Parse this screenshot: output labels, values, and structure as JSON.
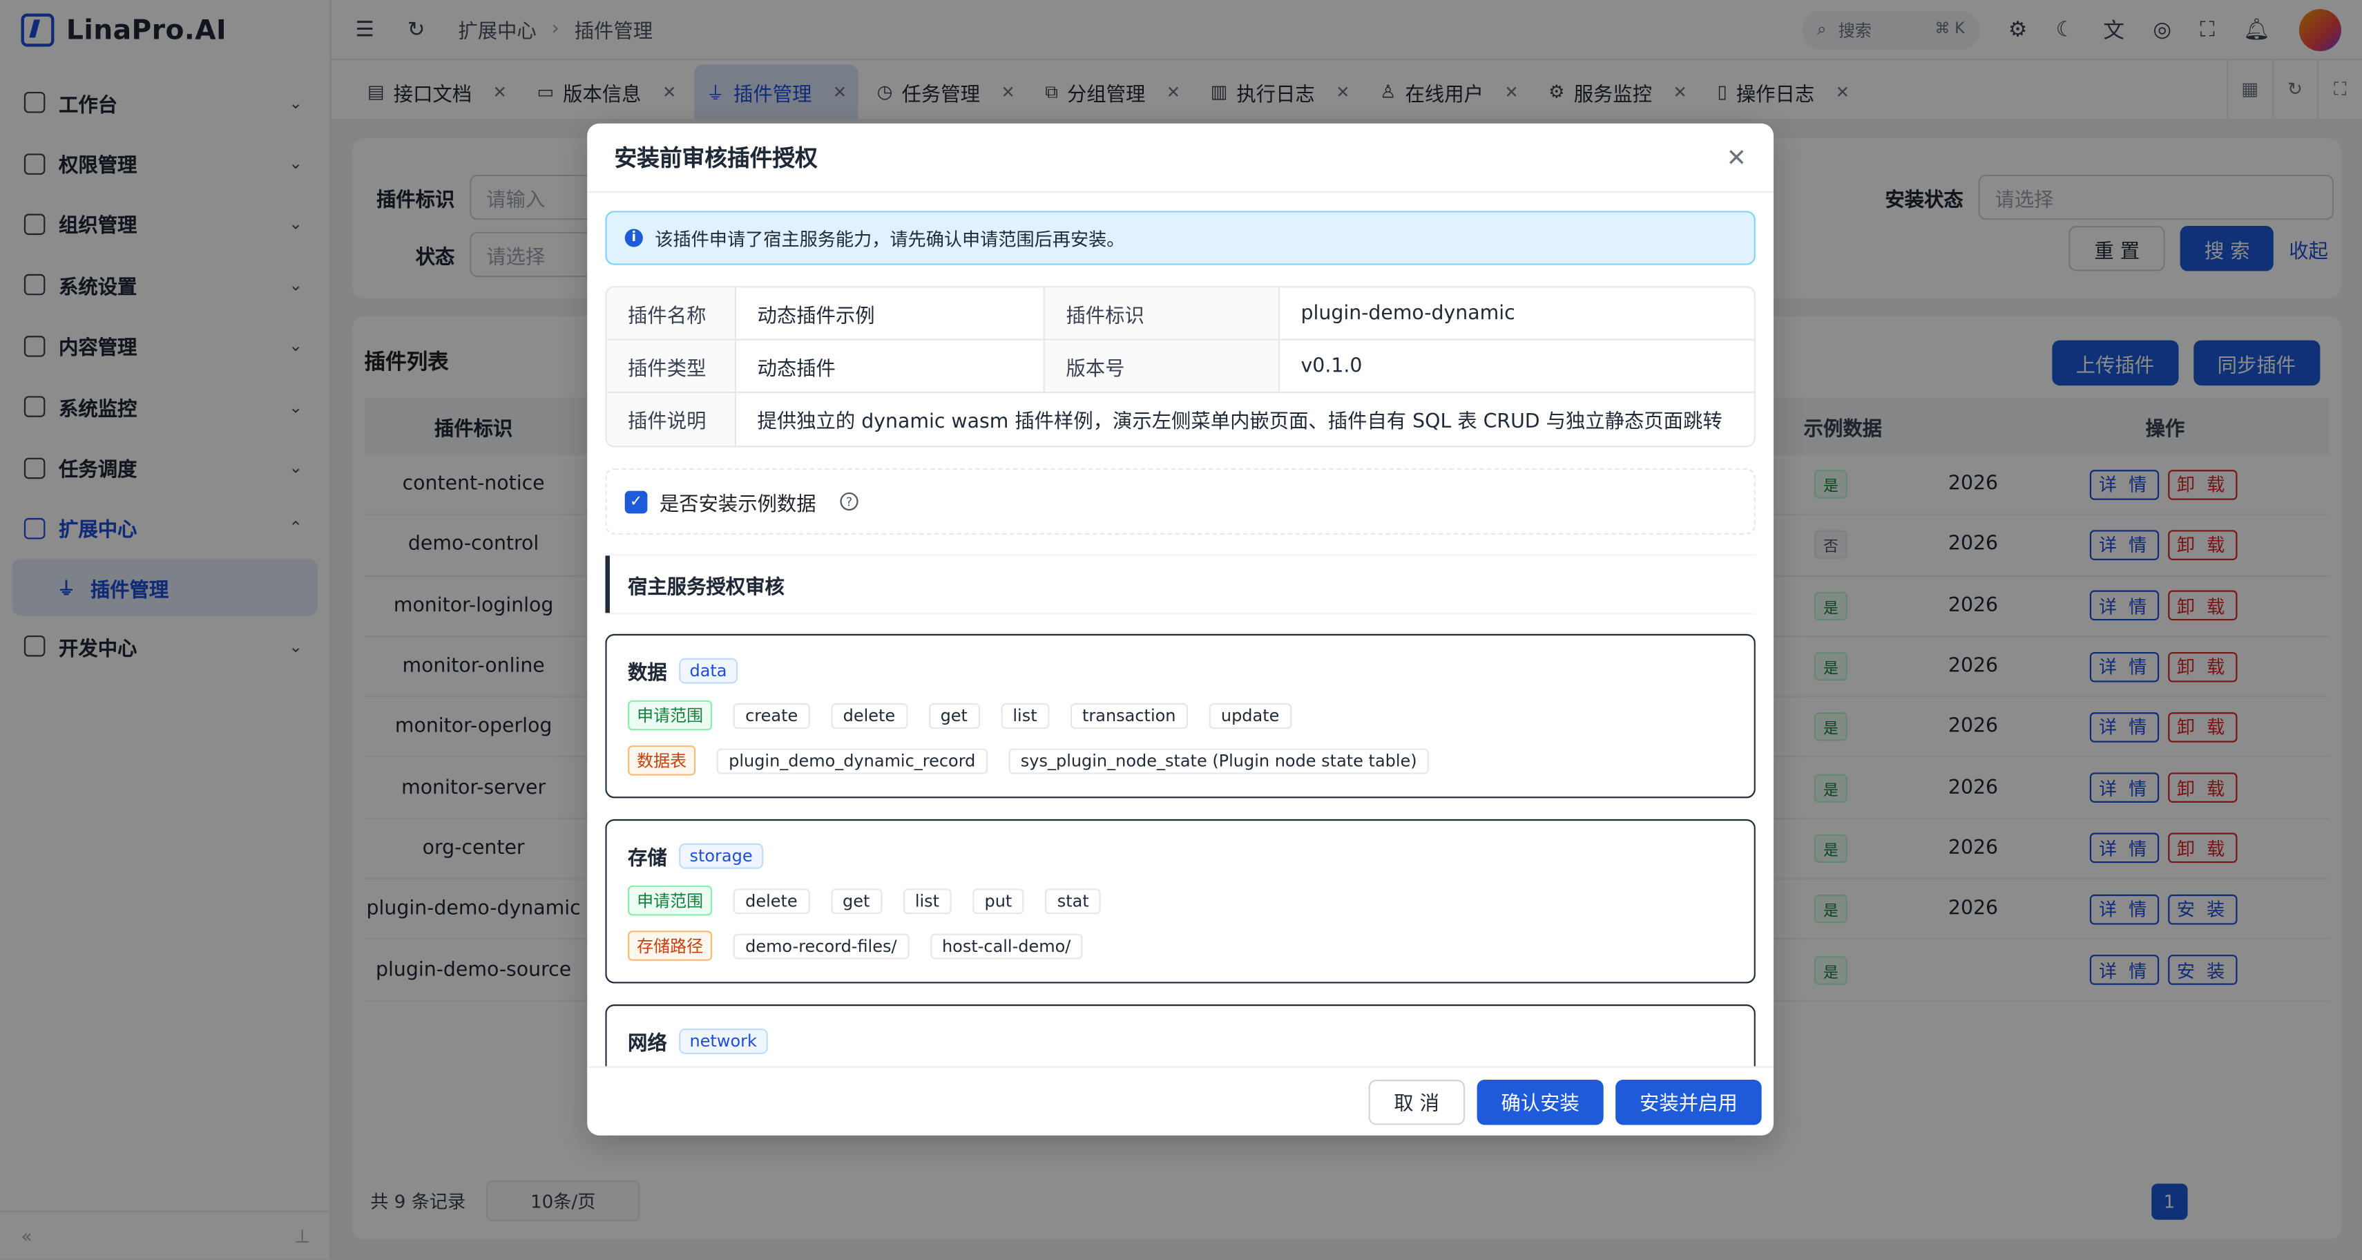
{
  "app": {
    "logo": "LinaPro.AI"
  },
  "sidebar": {
    "items": [
      {
        "label": "工作台",
        "icon": "dashboard-icon"
      },
      {
        "label": "权限管理",
        "icon": "shield-icon"
      },
      {
        "label": "组织管理",
        "icon": "org-icon"
      },
      {
        "label": "系统设置",
        "icon": "settings-icon"
      },
      {
        "label": "内容管理",
        "icon": "content-icon"
      },
      {
        "label": "系统监控",
        "icon": "monitor-icon"
      },
      {
        "label": "任务调度",
        "icon": "calendar-icon"
      },
      {
        "label": "扩展中心",
        "icon": "extension-icon"
      },
      {
        "label": "开发中心",
        "icon": "flask-icon"
      }
    ],
    "sub_active": "插件管理"
  },
  "header": {
    "breadcrumb": [
      "扩展中心",
      "插件管理"
    ],
    "search_placeholder": "搜索",
    "search_kbd": "⌘ K"
  },
  "tabs": [
    "接口文档",
    "版本信息",
    "插件管理",
    "任务管理",
    "分组管理",
    "执行日志",
    "在线用户",
    "服务监控",
    "操作日志"
  ],
  "filter": {
    "label_key": "插件标识",
    "placeholder_input": "请输入",
    "label_status": "状态",
    "placeholder_select": "请选择",
    "label_install": "安装状态",
    "reset": "重 置",
    "search": "搜 索",
    "collapse": "收起"
  },
  "table": {
    "title": "插件列表",
    "upload": "上传插件",
    "sync": "同步插件",
    "head": {
      "key": "插件标识",
      "demo": "示例数据",
      "ops": "操作"
    },
    "rows": [
      {
        "key": "content-notice",
        "demo": "是",
        "date": "2026",
        "op1": "详 情",
        "op2": "卸 载"
      },
      {
        "key": "demo-control",
        "demo": "否",
        "date": "2026",
        "op1": "详 情",
        "op2": "卸 载"
      },
      {
        "key": "monitor-loginlog",
        "demo": "是",
        "date": "2026",
        "op1": "详 情",
        "op2": "卸 载"
      },
      {
        "key": "monitor-online",
        "demo": "是",
        "date": "2026",
        "op1": "详 情",
        "op2": "卸 载"
      },
      {
        "key": "monitor-operlog",
        "demo": "是",
        "date": "2026",
        "op1": "详 情",
        "op2": "卸 载"
      },
      {
        "key": "monitor-server",
        "demo": "是",
        "date": "2026",
        "op1": "详 情",
        "op2": "卸 载"
      },
      {
        "key": "org-center",
        "demo": "是",
        "date": "2026",
        "op1": "详 情",
        "op2": "卸 载"
      },
      {
        "key": "plugin-demo-dynamic",
        "demo": "是",
        "date": "2026",
        "op1": "详 情",
        "op2": "安 装"
      },
      {
        "key": "plugin-demo-source",
        "demo": "是",
        "date": "",
        "op1": "详 情",
        "op2": "安 装"
      }
    ],
    "total": "共 9 条记录",
    "page_size": "10条/页",
    "page": "1"
  },
  "modal": {
    "title": "安装前审核插件授权",
    "alert": "该插件申请了宿主服务能力，请先确认申请范围后再安装。",
    "desc": {
      "name_label": "插件名称",
      "name": "动态插件示例",
      "id_label": "插件标识",
      "id": "plugin-demo-dynamic",
      "type_label": "插件类型",
      "type": "动态插件",
      "ver_label": "版本号",
      "ver": "v0.1.0",
      "note_label": "插件说明",
      "note": "提供独立的 dynamic wasm 插件样例，演示左侧菜单内嵌页面、插件自有 SQL 表 CRUD 与独立静态页面跳转"
    },
    "check_label": "是否安装示例数据",
    "section_title": "宿主服务授权审核",
    "caps": [
      {
        "title": "数据",
        "tag": "data",
        "rows": [
          {
            "kind": "申请范围",
            "style": "green",
            "items": [
              "create",
              "delete",
              "get",
              "list",
              "transaction",
              "update"
            ]
          },
          {
            "kind": "数据表",
            "style": "orange",
            "items": [
              "plugin_demo_dynamic_record",
              "sys_plugin_node_state (Plugin node state table)"
            ]
          }
        ]
      },
      {
        "title": "存储",
        "tag": "storage",
        "rows": [
          {
            "kind": "申请范围",
            "style": "green",
            "items": [
              "delete",
              "get",
              "list",
              "put",
              "stat"
            ]
          },
          {
            "kind": "存储路径",
            "style": "orange",
            "items": [
              "demo-record-files/",
              "host-call-demo/"
            ]
          }
        ]
      },
      {
        "title": "网络",
        "tag": "network",
        "rows": []
      }
    ],
    "cancel": "取 消",
    "confirm": "确认安装",
    "confirm_enable": "安装并启用"
  }
}
